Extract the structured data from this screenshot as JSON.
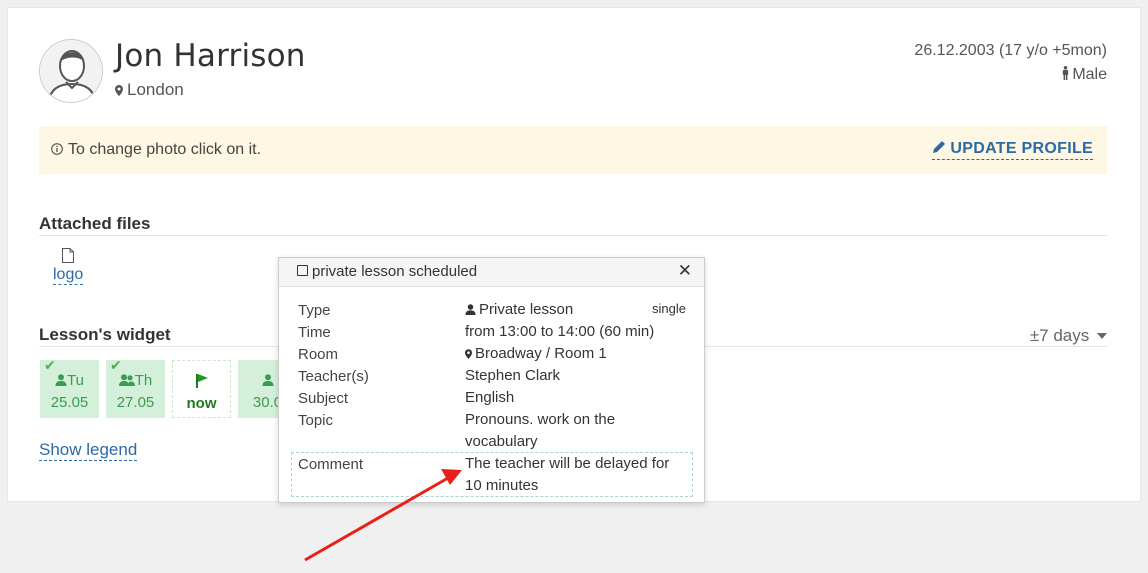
{
  "profile": {
    "name": "Jon Harrison",
    "city": "London",
    "birth": "26.12.2003 (17 y/o +5mon)",
    "gender": "Male",
    "avatar_icon": "user-avatar-icon"
  },
  "notice": {
    "text": "To change photo click on it.",
    "update_label": "UPDATE PROFILE"
  },
  "attached_files": {
    "title": "Attached files",
    "files": [
      {
        "name": "logo",
        "icon": "file-icon"
      }
    ]
  },
  "lessons_widget": {
    "title": "Lesson's widget",
    "range_label": "±7 days",
    "cells": [
      {
        "day": "Tu",
        "date": "25.05",
        "checked": true,
        "icon": "user-icon"
      },
      {
        "day": "Th",
        "date": "27.05",
        "checked": true,
        "icon": "users-icon"
      },
      {
        "day": "",
        "date": "now",
        "checked": false,
        "icon": "flag-icon"
      },
      {
        "day": "",
        "date": "30.0",
        "checked": false,
        "icon": "user-icon"
      }
    ],
    "show_legend": "Show legend"
  },
  "popover": {
    "title": "private lesson scheduled",
    "badge": "single",
    "rows": [
      {
        "label": "Type",
        "value": "Private lesson"
      },
      {
        "label": "Time",
        "value": "from 13:00 to 14:00 (60 min)"
      },
      {
        "label": "Room",
        "value": "Broadway / Room 1"
      },
      {
        "label": "Teacher(s)",
        "value": "Stephen Clark"
      },
      {
        "label": "Subject",
        "value": "English"
      },
      {
        "label": "Topic",
        "value": "Pronouns. work on the vocabulary"
      },
      {
        "label": "Comment",
        "value": "The teacher will be delayed for 10 minutes"
      }
    ]
  },
  "colors": {
    "link": "#2b6aa6",
    "green_bg": "#d5f0da",
    "green_text": "#3a9d4f",
    "notice_bg": "#fdf7e3",
    "annotation_arrow": "#e8201a"
  }
}
